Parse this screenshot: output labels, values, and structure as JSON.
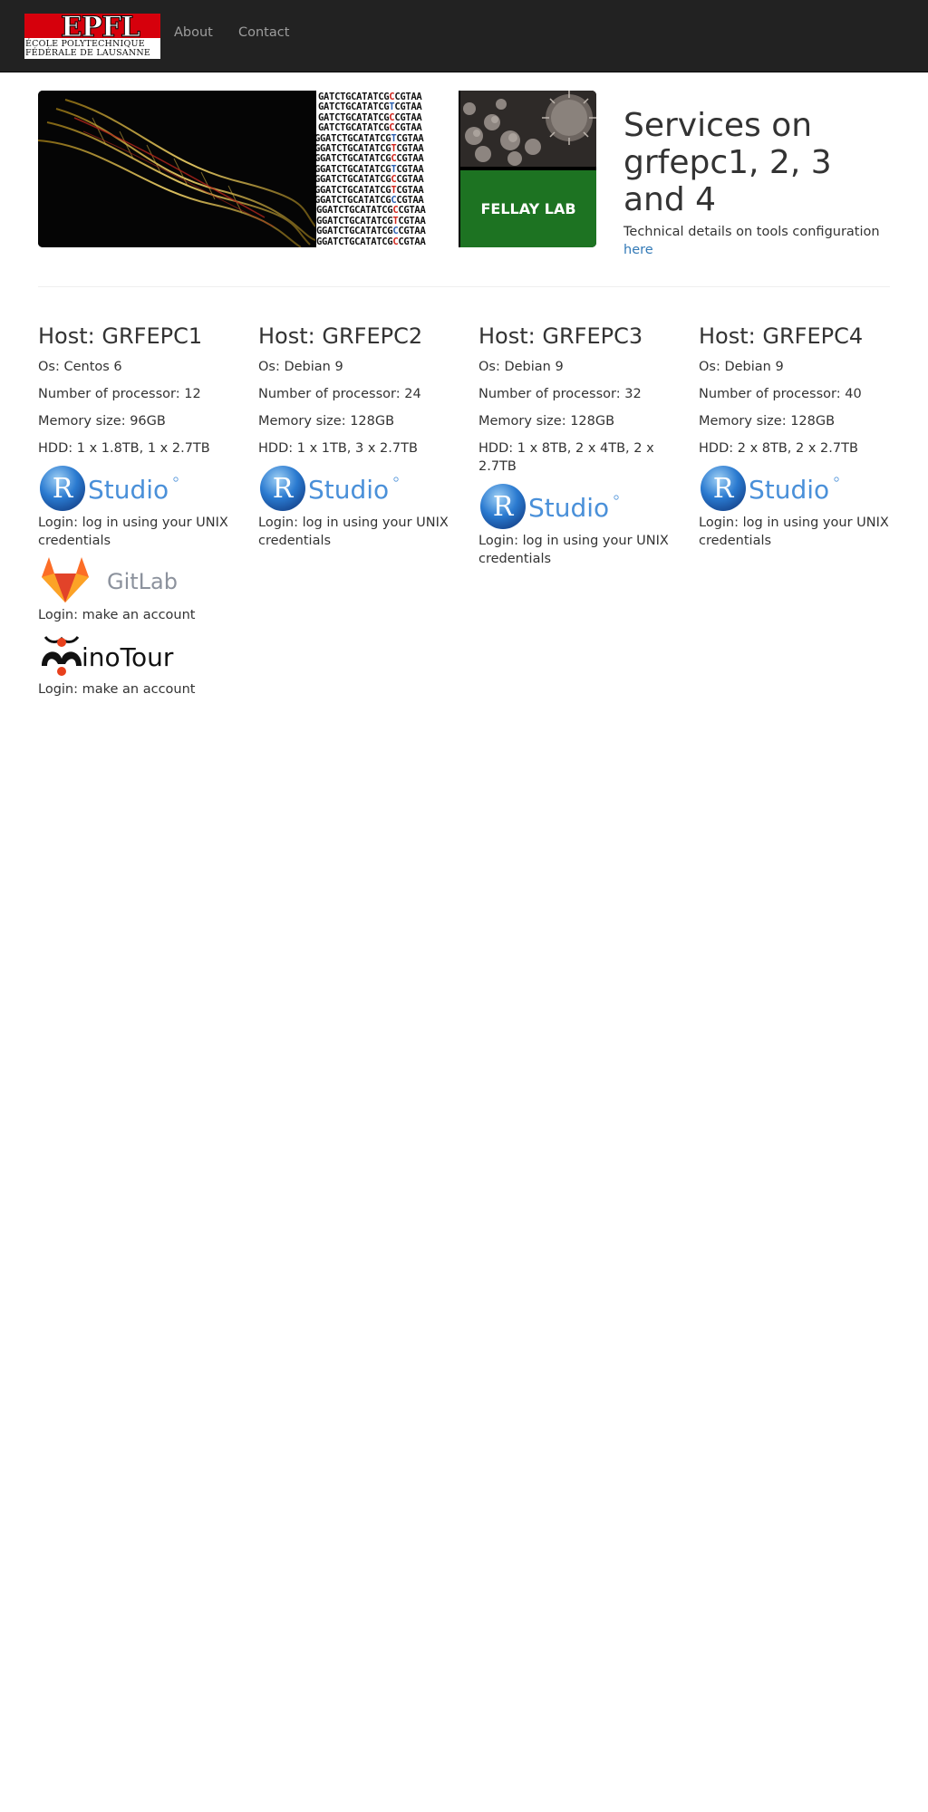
{
  "navbar": {
    "logo_text": "EPFL",
    "logo_line1": "ÉCOLE POLYTECHNIQUE",
    "logo_line2": "FÉDÉRALE DE LAUSANNE",
    "links": [
      "About",
      "Contact"
    ]
  },
  "hero": {
    "banner_label": "FELLAY LAB",
    "sequence_lines": [
      "GATCTGCATATCGCCGTAA",
      "GATCTGCATATCGTCGTAA",
      "GATCTGCATATCGCCGTAA",
      "GATCTGCATATCGCCGTAA",
      "GGATCTGCATATCGTCGTAA",
      "GGATCTGCATATCGTCGTAA",
      "GGATCTGCATATCGCCGTAA",
      "GGATCTGCATATCGTCGTAA",
      "GGATCTGCATATCGCCGTAA",
      "GGATCTGCATATCGTCGTAA",
      "GGATCTGCATATCGCCGTAA",
      "AGGATCTGCATATCGCCGTAA",
      "AGGATCTGCATATCGTCGTAA",
      "AGGATCTGCATATCGCCGTAA",
      "AGGATCTGCATATCGCCGTAA"
    ],
    "title": "Services on grfepc1, 2, 3 and 4",
    "subtitle": "Technical details on tools configuration",
    "subtitle_link": "here"
  },
  "hosts": [
    {
      "title": "Host: GRFEPC1",
      "os": "Os: Centos 6",
      "cpu": "Number of processor: 12",
      "memory": "Memory size: 96GB",
      "hdd": "HDD: 1 x 1.8TB, 1 x 2.7TB",
      "services": [
        {
          "logo": "Studio",
          "login": "Login: log in using your UNIX credentials"
        },
        {
          "logo": "GitLab",
          "login": "Login: make an account"
        },
        {
          "logo": "inoTour",
          "login": "Login: make an account"
        }
      ]
    },
    {
      "title": "Host: GRFEPC2",
      "os": "Os: Debian 9",
      "cpu": "Number of processor: 24",
      "memory": "Memory size: 128GB",
      "hdd": "HDD: 1 x 1TB, 3 x 2.7TB",
      "services": [
        {
          "logo": "Studio",
          "login": "Login: log in using your UNIX credentials"
        }
      ]
    },
    {
      "title": "Host: GRFEPC3",
      "os": "Os: Debian 9",
      "cpu": "Number of processor: 32",
      "memory": "Memory size: 128GB",
      "hdd": "HDD: 1 x 8TB, 2 x 4TB, 2 x 2.7TB",
      "services": [
        {
          "logo": "Studio",
          "login": "Login: log in using your UNIX credentials"
        }
      ]
    },
    {
      "title": "Host: GRFEPC4",
      "os": "Os: Debian 9",
      "cpu": "Number of processor: 40",
      "memory": "Memory size: 128GB",
      "hdd": "HDD: 2 x 8TB, 2 x 2.7TB",
      "services": [
        {
          "logo": "Studio",
          "login": "Login: log in using your UNIX credentials"
        }
      ]
    }
  ],
  "colors": {
    "navbar": "#222222",
    "nav_link": "#9d9d9d",
    "link": "#337ab7",
    "epfl_red": "#d6000c",
    "lab_green": "#1d7322",
    "rstudio_blue": "#4a90d9",
    "gitlab_orange": "#e24329",
    "minotour_red": "#e8401c"
  }
}
